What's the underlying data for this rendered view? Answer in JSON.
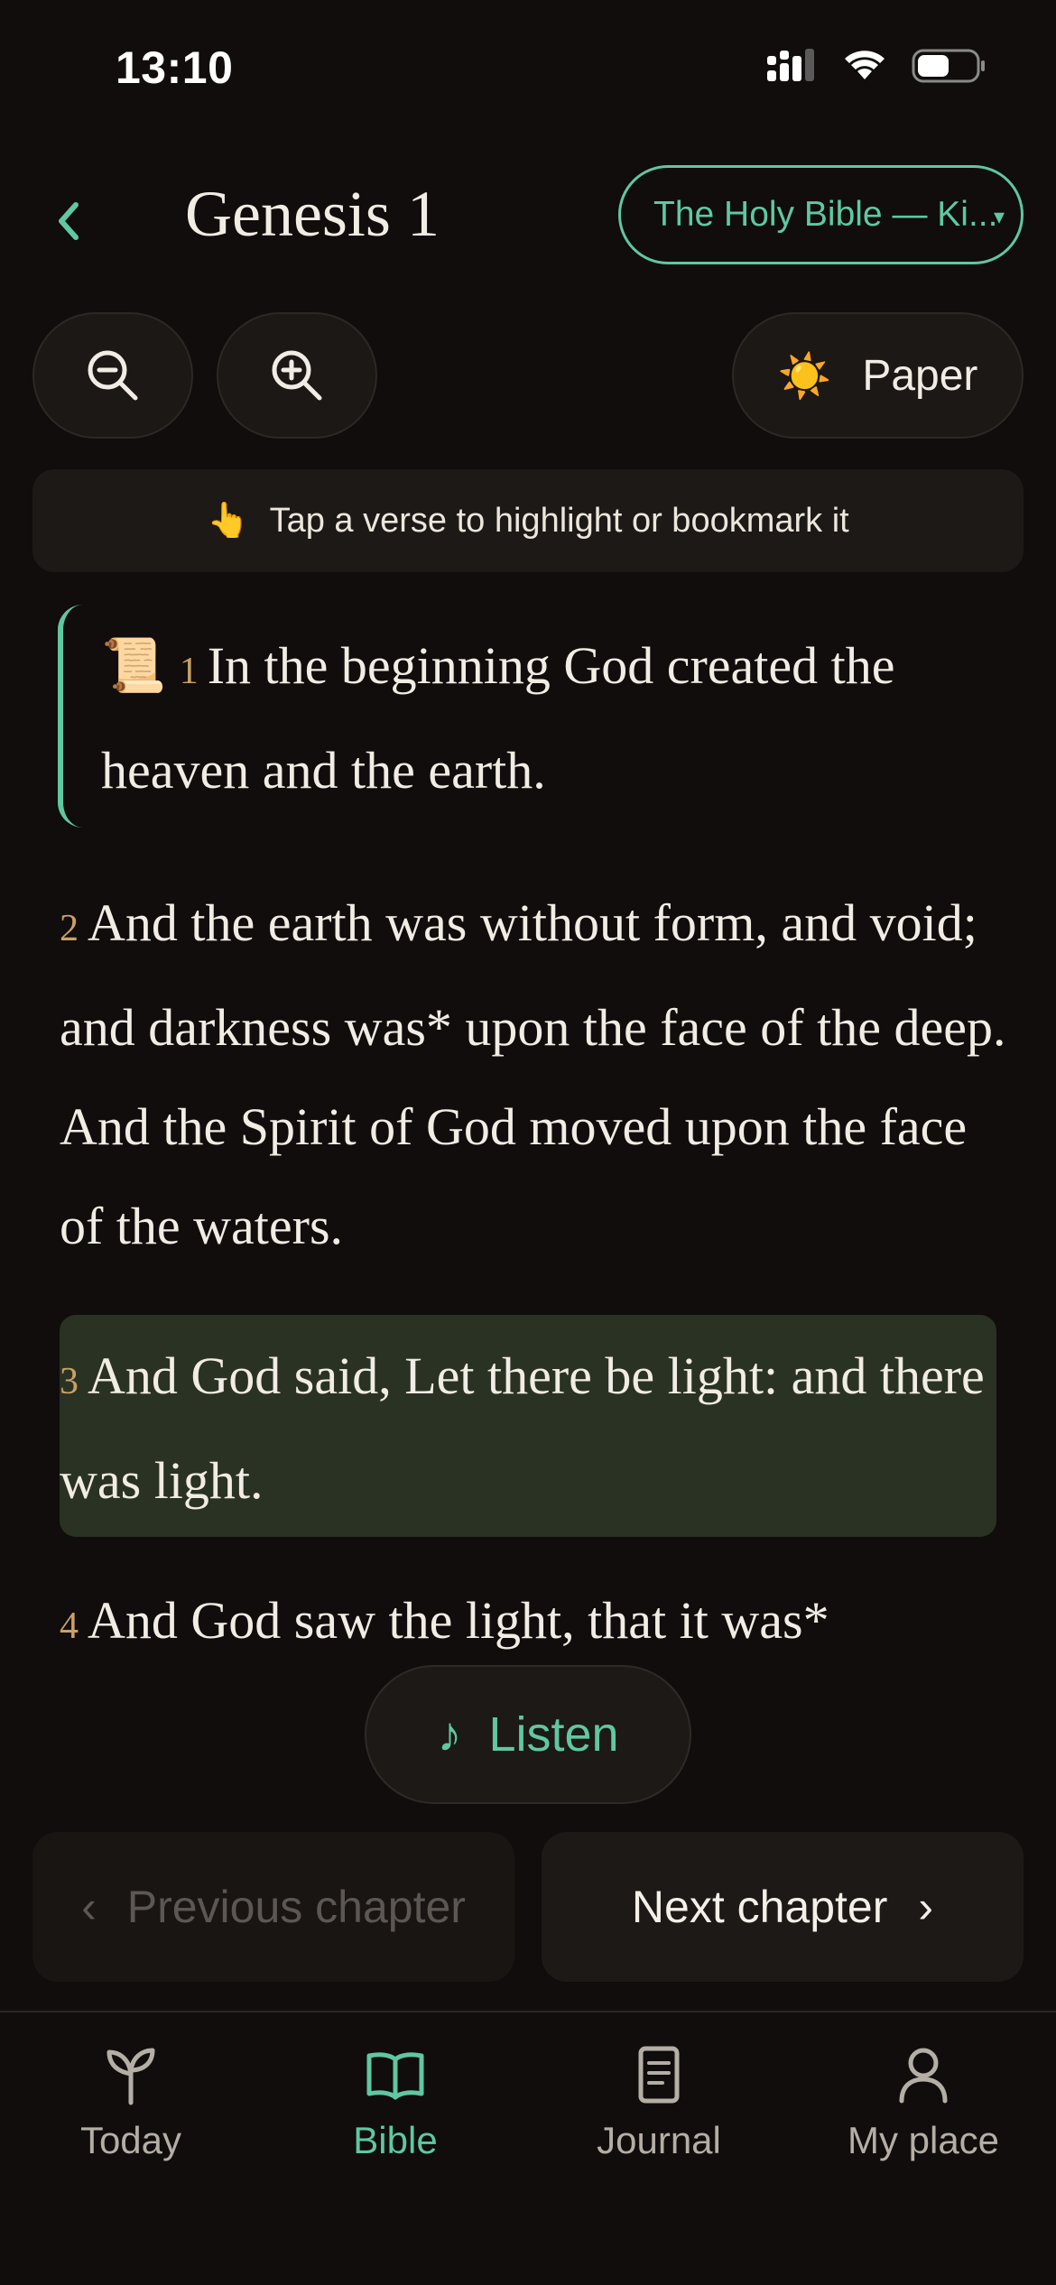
{
  "status_bar": {
    "time": "13:10"
  },
  "header": {
    "title": "Genesis 1",
    "version": "The Holy Bible — Ki...",
    "version_caret": "▾",
    "back_icon": "chevron-left-icon"
  },
  "controls": {
    "zoom_out_icon": "zoom-out-icon",
    "zoom_in_icon": "zoom-in-icon",
    "theme_icon": "☀️",
    "theme_label": "Paper"
  },
  "hint": {
    "emoji": "👆",
    "text": "Tap a verse to highlight or bookmark it"
  },
  "verses": [
    {
      "num": "1",
      "text": "In the beginning God created the heaven and the earth.",
      "bookmark_icon": "📜",
      "bookmarked": true
    },
    {
      "num": "2",
      "text": "And the earth was without form, and void; and darkness was* upon the face of the deep. And the Spirit of God moved upon the face of the waters."
    },
    {
      "num": "3",
      "text": "And God said, Let there be light: and there was light.",
      "highlight_color": "#2a3224"
    },
    {
      "num": "4",
      "text": "And God saw the light, that it was*"
    }
  ],
  "listen": {
    "icon": "♪",
    "label": "Listen"
  },
  "chapter_nav": {
    "prev_icon": "‹",
    "prev_label": "Previous chapter",
    "next_label": "Next chapter",
    "next_icon": "›"
  },
  "tabs": [
    {
      "label": "Today",
      "icon": "sprout-icon",
      "active": false
    },
    {
      "label": "Bible",
      "icon": "book-icon",
      "active": true
    },
    {
      "label": "Journal",
      "icon": "journal-icon",
      "active": false
    },
    {
      "label": "My place",
      "icon": "person-icon",
      "active": false
    }
  ],
  "colors": {
    "accent": "#5fc8a0",
    "verse_number": "#c9a066",
    "background": "#100d0c",
    "highlight": "#2a3224"
  }
}
